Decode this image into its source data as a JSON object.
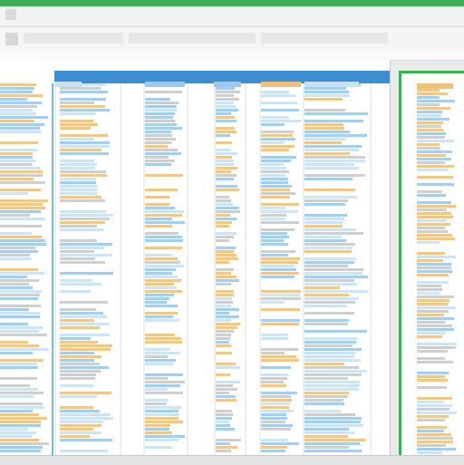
{
  "window": {
    "title": "",
    "accent_color": "#3cae55",
    "highlight_color": "#3d8ed0"
  },
  "title_bar": {
    "tabs": []
  },
  "ribbon": {
    "buttons": []
  },
  "spreadsheet": {
    "left_panel": {
      "description_hidden": ""
    },
    "right_panel": {
      "description_hidden": ""
    },
    "row_colors": {
      "orange": "#f0c07a",
      "blue": "#9bc8ec",
      "light_blue": "#c9e1f4",
      "gray": "#c9c9c9",
      "white": "#ffffff"
    }
  },
  "icons": [
    {
      "name": "app-logo-icon",
      "glyph": "▦"
    },
    {
      "name": "toolbar-icon",
      "glyph": "▤"
    }
  ]
}
